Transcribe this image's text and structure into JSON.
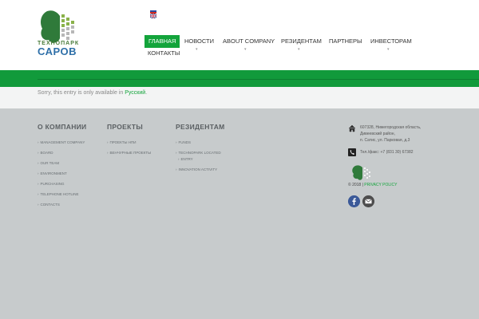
{
  "header": {
    "logo_top": "ТЕХНОПАРК",
    "logo_name": "САРОВ",
    "languages": [
      "ru-flag",
      "uk-flag"
    ]
  },
  "nav": {
    "items": [
      {
        "label": "ГЛАВНАЯ",
        "active": true
      },
      {
        "label": "НОВОСТИ",
        "dropdown": true
      },
      {
        "label": "ABOUT COMPANY",
        "dropdown": true
      },
      {
        "label": "РЕЗИДЕНТАМ",
        "dropdown": true
      },
      {
        "label": "ПАРТНЕРЫ"
      },
      {
        "label": "ИНВЕСТОРАМ",
        "dropdown": true
      },
      {
        "label": "КОНТАКТЫ"
      }
    ]
  },
  "notice": {
    "text": "Sorry, this entry is only available in ",
    "link": "Русский",
    "end": "."
  },
  "footer": {
    "col1": {
      "title": "О КОМПАНИИ",
      "items": [
        "MANAGEMENT COMPANY",
        "BOARD",
        "OUR TEAM",
        "ENVIRONMENT",
        "PURCHASING",
        "TELEPHONE HOTLINE",
        "CONTACTS"
      ]
    },
    "col2": {
      "title": "ПРОЕКТЫ",
      "items": [
        "ПРОЕКТЫ НПИ",
        "ВЕНЧУРНЫЕ ПРОЕКТЫ"
      ]
    },
    "col3": {
      "title": "РЕЗИДЕНТАМ",
      "items": [
        "FUNDS",
        "TECHNOPARK LOCATED",
        "ENTRY",
        "INNOVATION ACTIVITY"
      ]
    },
    "contact": {
      "addr1": "607328, Нижегородская область,",
      "addr2": "Дивеевский район,",
      "addr3": "п. Сатис, ул. Парковая, д.3",
      "phone": "Тел./факс: +7 (831 30) 67382",
      "copyright": "© 2018 |",
      "privacy": "PRIVACY POLICY"
    }
  },
  "colors": {
    "accent": "#13a43b",
    "footer_bg": "#c7cbcc"
  }
}
